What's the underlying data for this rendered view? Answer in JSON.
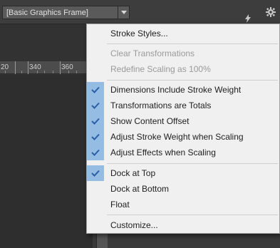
{
  "control_bar": {
    "object_style_value": "[Basic Graphics Frame]",
    "icons": [
      "chevron-down-icon",
      "lightning-icon",
      "gear-icon"
    ]
  },
  "ruler": {
    "labels": [
      "20",
      "340",
      "360"
    ]
  },
  "menu": {
    "check_color": "#2a5ea8",
    "check_bg": "#95bde4",
    "items": [
      {
        "label": "Stroke Styles...",
        "checked": false,
        "enabled": true
      },
      {
        "label": "Clear Transformations",
        "checked": false,
        "enabled": false
      },
      {
        "label": "Redefine Scaling as 100%",
        "checked": false,
        "enabled": false
      },
      {
        "label": "Dimensions Include Stroke Weight",
        "checked": true,
        "enabled": true
      },
      {
        "label": "Transformations are Totals",
        "checked": true,
        "enabled": true
      },
      {
        "label": "Show Content Offset",
        "checked": true,
        "enabled": true
      },
      {
        "label": "Adjust Stroke Weight when Scaling",
        "checked": true,
        "enabled": true
      },
      {
        "label": "Adjust Effects when Scaling",
        "checked": true,
        "enabled": true
      },
      {
        "label": "Dock at Top",
        "checked": true,
        "enabled": true
      },
      {
        "label": "Dock at Bottom",
        "checked": false,
        "enabled": true
      },
      {
        "label": "Float",
        "checked": false,
        "enabled": true
      },
      {
        "label": "Customize...",
        "checked": false,
        "enabled": true
      }
    ]
  }
}
